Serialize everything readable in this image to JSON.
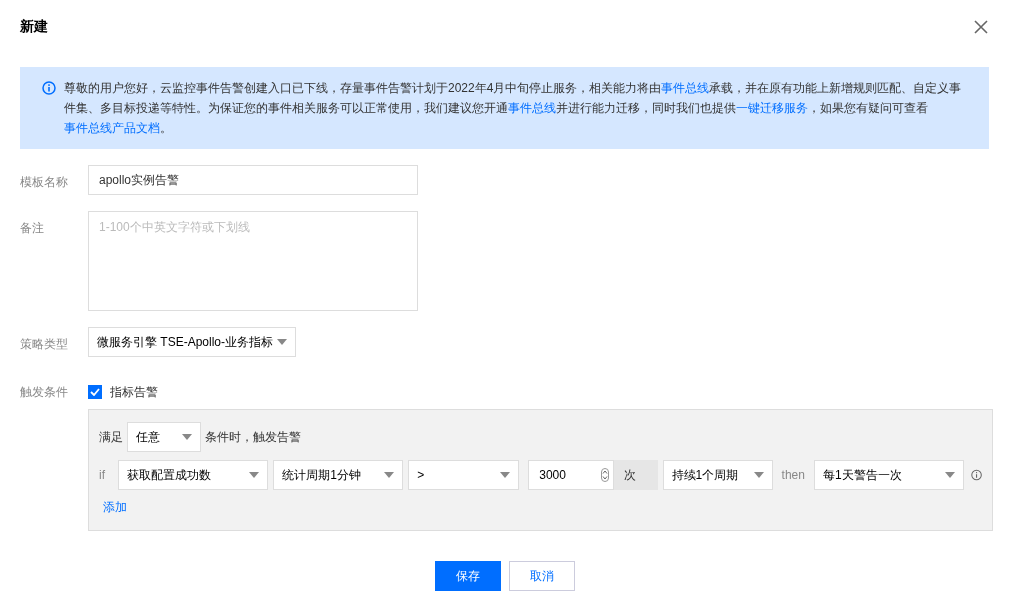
{
  "dialog": {
    "title": "新建"
  },
  "notice": {
    "segments": [
      {
        "kind": "text",
        "text": "尊敬的用户您好，云监控事件告警创建入口已下线，存量事件告警计划于2022年4月中旬停止服务，相关能力将由"
      },
      {
        "kind": "link",
        "text": "事件总线"
      },
      {
        "kind": "text",
        "text": "承载，并在原有功能上新增规则匹配、自定义事件集、多目标投递等特性。为保证您的事件相关服务可以正常使用，我们建议您开通"
      },
      {
        "kind": "link",
        "text": "事件总线"
      },
      {
        "kind": "text",
        "text": "并进行能力迁移，同时我们也提供"
      },
      {
        "kind": "link",
        "text": "一键迁移服务"
      },
      {
        "kind": "text",
        "text": "，如果您有疑问可查看"
      },
      {
        "kind": "link",
        "text": "事件总线产品文档"
      },
      {
        "kind": "text",
        "text": "。"
      }
    ]
  },
  "fields": [
    {
      "label": "模板名称",
      "kind": "input",
      "value": "apollo实例告警"
    },
    {
      "label": "备注",
      "kind": "textarea",
      "placeholder": "1-100个中英文字符或下划线"
    },
    {
      "label": "策略类型",
      "kind": "select",
      "value": "微服务引擎 TSE-Apollo-业务指标"
    }
  ],
  "trigger": {
    "label": "触发条件",
    "checkbox": {
      "label": "指标告警",
      "checked": true
    },
    "match": {
      "prefix": "满足",
      "value": "任意",
      "suffix": "条件时，触发告警"
    },
    "rules": [
      {
        "if": "if",
        "metric": "获取配置成功数",
        "period": "统计周期1分钟",
        "operator": ">",
        "threshold": "3000",
        "unit": "次",
        "duration": "持续1个周期",
        "then": "then",
        "frequency": "每1天警告一次"
      }
    ],
    "add": "添加"
  },
  "buttons": [
    {
      "label": "保存",
      "kind": "primary"
    },
    {
      "label": "取消",
      "kind": "secondary"
    }
  ]
}
